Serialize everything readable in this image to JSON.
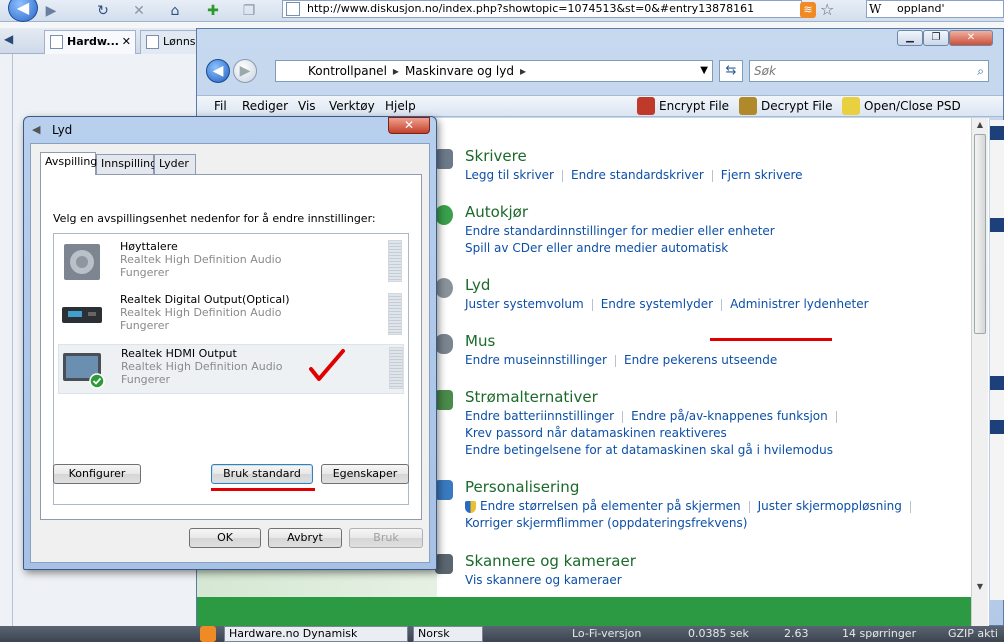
{
  "browser": {
    "url": "http://www.diskusjon.no/index.php?showtopic=1074513&st=0&#entry13878161",
    "search_value": "oppland'",
    "search_engine_glyph": "W",
    "tabs": [
      {
        "label": "Hardw...",
        "active": true
      },
      {
        "label": "Lønns",
        "active": false
      }
    ]
  },
  "status_bar": {
    "page_title": "Hardware.no Dynamisk",
    "language": "Norsk",
    "lofi": "Lo-Fi-versjon",
    "time": "0.0385 sek",
    "load": "2.63",
    "queries": "14 spørringer",
    "gzip": "GZIP akti"
  },
  "control_panel": {
    "breadcrumb": [
      "Kontrollpanel",
      "Maskinvare og lyd"
    ],
    "search_placeholder": "Søk",
    "menu": [
      "Fil",
      "Rediger",
      "Vis",
      "Verktøy",
      "Hjelp"
    ],
    "tools": [
      "Encrypt File",
      "Decrypt File",
      "Open/Close PSD"
    ],
    "categories": [
      {
        "title": "Skrivere",
        "links": [
          [
            "Legg til skriver",
            "Endre standardskriver",
            "Fjern skrivere"
          ]
        ]
      },
      {
        "title": "Autokjør",
        "links": [
          [
            "Endre standardinnstillinger for medier eller enheter"
          ],
          [
            "Spill av CDer eller andre medier automatisk"
          ]
        ]
      },
      {
        "title": "Lyd",
        "links": [
          [
            "Juster systemvolum",
            "Endre systemlyder",
            "Administrer lydenheter"
          ]
        ]
      },
      {
        "title": "Mus",
        "links": [
          [
            "Endre museinnstillinger",
            "Endre pekerens utseende"
          ]
        ]
      },
      {
        "title": "Strømalternativer",
        "links": [
          [
            "Endre batteriinnstillinger",
            "Endre på/av-knappenes funksjon"
          ],
          [
            "Krev passord når datamaskinen reaktiveres"
          ],
          [
            "Endre betingelsene for at datamaskinen skal gå i hvilemodus"
          ]
        ]
      },
      {
        "title": "Personalisering",
        "links": [
          [
            "Endre størrelsen på elementer på skjermen",
            "Juster skjermoppløsning"
          ],
          [
            "Korriger skjermflimmer (oppdateringsfrekvens)"
          ]
        ]
      },
      {
        "title": "Skannere og kameraer",
        "links": [
          [
            "Vis skannere og kameraer"
          ]
        ]
      }
    ]
  },
  "sound_dialog": {
    "title": "Lyd",
    "tabs": [
      "Avspilling",
      "Innspilling",
      "Lyder"
    ],
    "instruction": "Velg en avspillingsenhet nedenfor for å endre innstillinger:",
    "devices": [
      {
        "name": "Høyttalere",
        "driver": "Realtek High Definition Audio",
        "status": "Fungerer",
        "selected": false
      },
      {
        "name": "Realtek Digital Output(Optical)",
        "driver": "Realtek High Definition Audio",
        "status": "Fungerer",
        "selected": false
      },
      {
        "name": "Realtek HDMI Output",
        "driver": "Realtek High Definition Audio",
        "status": "Fungerer",
        "selected": true
      }
    ],
    "buttons": {
      "configure": "Konfigurer",
      "set_default": "Bruk standard",
      "properties": "Egenskaper",
      "ok": "OK",
      "cancel": "Avbryt",
      "apply": "Bruk"
    }
  },
  "colors": {
    "annotation_red": "#e00000",
    "link_blue": "#0c4fa8",
    "category_green": "#1a6a2a"
  }
}
